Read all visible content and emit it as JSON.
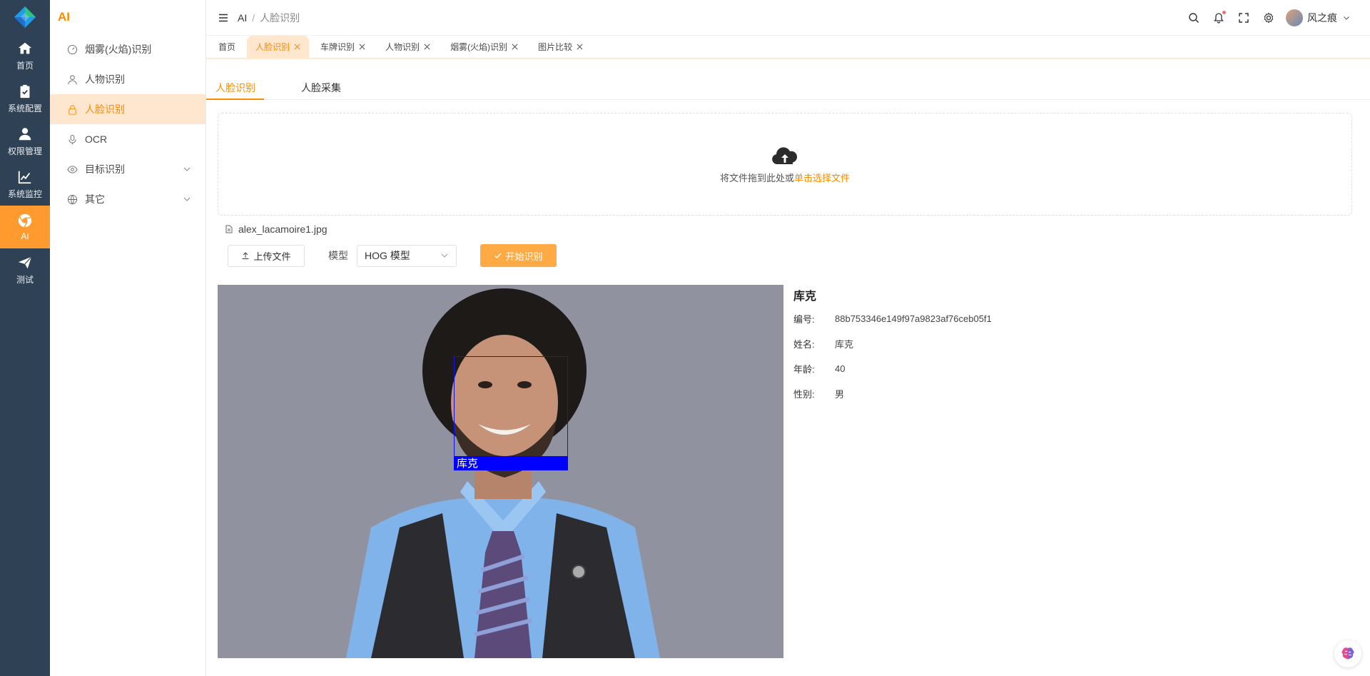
{
  "rail": {
    "items": [
      {
        "label": "首页",
        "icon": "home-icon"
      },
      {
        "label": "系统配置",
        "icon": "clipboard-check-icon"
      },
      {
        "label": "权限管理",
        "icon": "user-icon"
      },
      {
        "label": "系统监控",
        "icon": "chart-icon"
      },
      {
        "label": "AI",
        "icon": "chrome-icon"
      },
      {
        "label": "测试",
        "icon": "paper-plane-icon"
      }
    ],
    "active_color": "#ff9a2e",
    "bg_color": "#2f4154"
  },
  "sidebar": {
    "title": "AI",
    "items": [
      {
        "label": "烟雾(火焰)识别",
        "icon": "gauge-icon"
      },
      {
        "label": "人物识别",
        "icon": "user-outline-icon"
      },
      {
        "label": "人脸识别",
        "icon": "lock-icon"
      },
      {
        "label": "OCR",
        "icon": "microphone-icon"
      },
      {
        "label": "目标识别",
        "icon": "eye-icon"
      },
      {
        "label": "其它",
        "icon": "globe-icon"
      }
    ]
  },
  "header": {
    "breadcrumb_root": "AI",
    "breadcrumb_sep": "/",
    "breadcrumb_current": "人脸识别",
    "user_name": "风之痕"
  },
  "tabs": [
    {
      "label": "首页"
    },
    {
      "label": "人脸识别"
    },
    {
      "label": "车牌识别"
    },
    {
      "label": "人物识别"
    },
    {
      "label": "烟雾(火焰)识别"
    },
    {
      "label": "图片比较"
    }
  ],
  "subtabs": {
    "active": "人脸识别",
    "other": "人脸采集"
  },
  "upload": {
    "drop_text": "将文件拖到此处或",
    "drop_link": "单击选择文件",
    "file_name": "alex_lacamoire1.jpg",
    "upload_button": "上传文件",
    "model_label": "模型",
    "model_value": "HOG 模型",
    "start_button": "开始识别"
  },
  "result": {
    "face_label": "库克",
    "title": "库克",
    "fields": [
      {
        "key": "编号:",
        "value": "88b753346e149f97a9823af76ceb05f1"
      },
      {
        "key": "姓名:",
        "value": "库克"
      },
      {
        "key": "年龄:",
        "value": "40"
      },
      {
        "key": "性别:",
        "value": "男"
      }
    ]
  },
  "colors": {
    "accent": "#ff8a00",
    "accent_light": "#ffe7cf",
    "face_box": "#0000ff"
  }
}
